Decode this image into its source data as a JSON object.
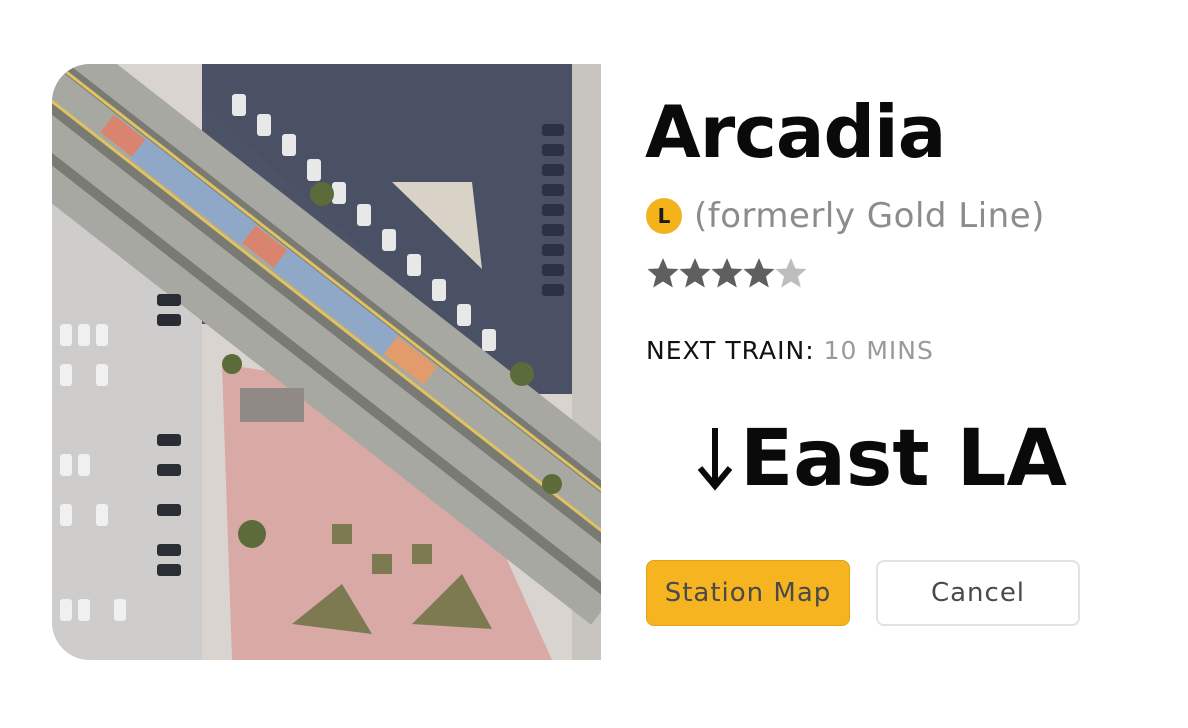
{
  "station": {
    "name": "Arcadia",
    "line_letter": "L",
    "line_note": "(formerly Gold Line)",
    "line_color": "#f3b21a",
    "rating": 4,
    "rating_max": 5
  },
  "next_train": {
    "label": "NEXT TRAIN:",
    "value": "10 MINS"
  },
  "direction": {
    "arrow_icon": "arrow-down-icon",
    "destination": "East LA"
  },
  "buttons": {
    "station_map": "Station Map",
    "cancel": "Cancel"
  },
  "colors": {
    "accent": "#f6b421",
    "star_filled": "#5f5f5f",
    "star_empty": "#bdbdbd"
  }
}
